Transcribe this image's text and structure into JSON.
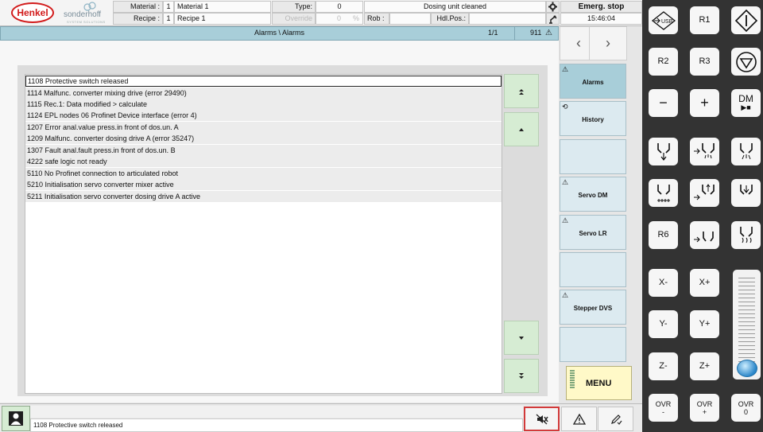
{
  "header": {
    "brand": "Henkel",
    "brand2": "sonderhoff",
    "brand2_sub": "SYSTEM SOLUTIONS",
    "material_label": "Material :",
    "material_no": "1",
    "material_name": "Material 1",
    "recipe_label": "Recipe :",
    "recipe_no": "1",
    "recipe_name": "Recipe 1",
    "type_label": "Type:",
    "type_value": "0",
    "override_label": "Override",
    "override_value": "0",
    "override_unit": "%",
    "status_text": "Dosing unit cleaned",
    "rob_label": "Rob :",
    "hdl_label": "Hdl.Pos.:",
    "emergency": "Emerg. stop",
    "time": "15:46:04"
  },
  "titlebar": {
    "title": "Alarms \\ Alarms",
    "page": "1/1",
    "count": "911"
  },
  "nav": {
    "prev": "‹",
    "next": "›"
  },
  "alarms": [
    "1108 Protective switch released",
    "1114 Malfunc. converter mixing drive (error 29490)",
    "1115 Rec.1: Data modified > calculate",
    "1124 EPL nodes 06 Profinet Device interface (error 4)",
    "1207 Error anal.value press.in front of dos.un. A",
    "1209 Malfunc. converter dosing drive A  (error 35247)",
    "1307 Fault anal.fault press.in front of dos.un. B",
    "4222 safe logic not ready",
    "5110 No Profinet connection to articulated robot",
    "5210 Initialisation servo converter mixer active",
    "5211 Initialisation servo converter dosing drive A active"
  ],
  "tabs": {
    "alarms": "Alarms",
    "history": "History",
    "servo_dm": "Servo DM",
    "servo_lr": "Servo LR",
    "stepper_dvs": "Stepper DVS",
    "menu": "MENU"
  },
  "status": {
    "message": "1108 Protective switch released"
  },
  "keypad": {
    "usb": "USB",
    "r1": "R1",
    "r2": "R2",
    "r3": "R3",
    "minus": "−",
    "plus": "+",
    "dm": "DM",
    "r6": "R6",
    "xm": "X-",
    "xp": "X+",
    "ym": "Y-",
    "yp": "Y+",
    "zm": "Z-",
    "zp": "Z+",
    "ovr_minus_1": "OVR",
    "ovr_minus_2": "-",
    "ovr_plus_1": "OVR",
    "ovr_plus_2": "+",
    "ovr_zero_1": "OVR",
    "ovr_zero_2": "0"
  },
  "colors": {
    "title_blue": "#a8ced9",
    "button_green": "#d6ecd3",
    "menu_yellow": "#fff9c8",
    "keypad_bg": "#333333",
    "henkel_red": "#d21b1b"
  }
}
